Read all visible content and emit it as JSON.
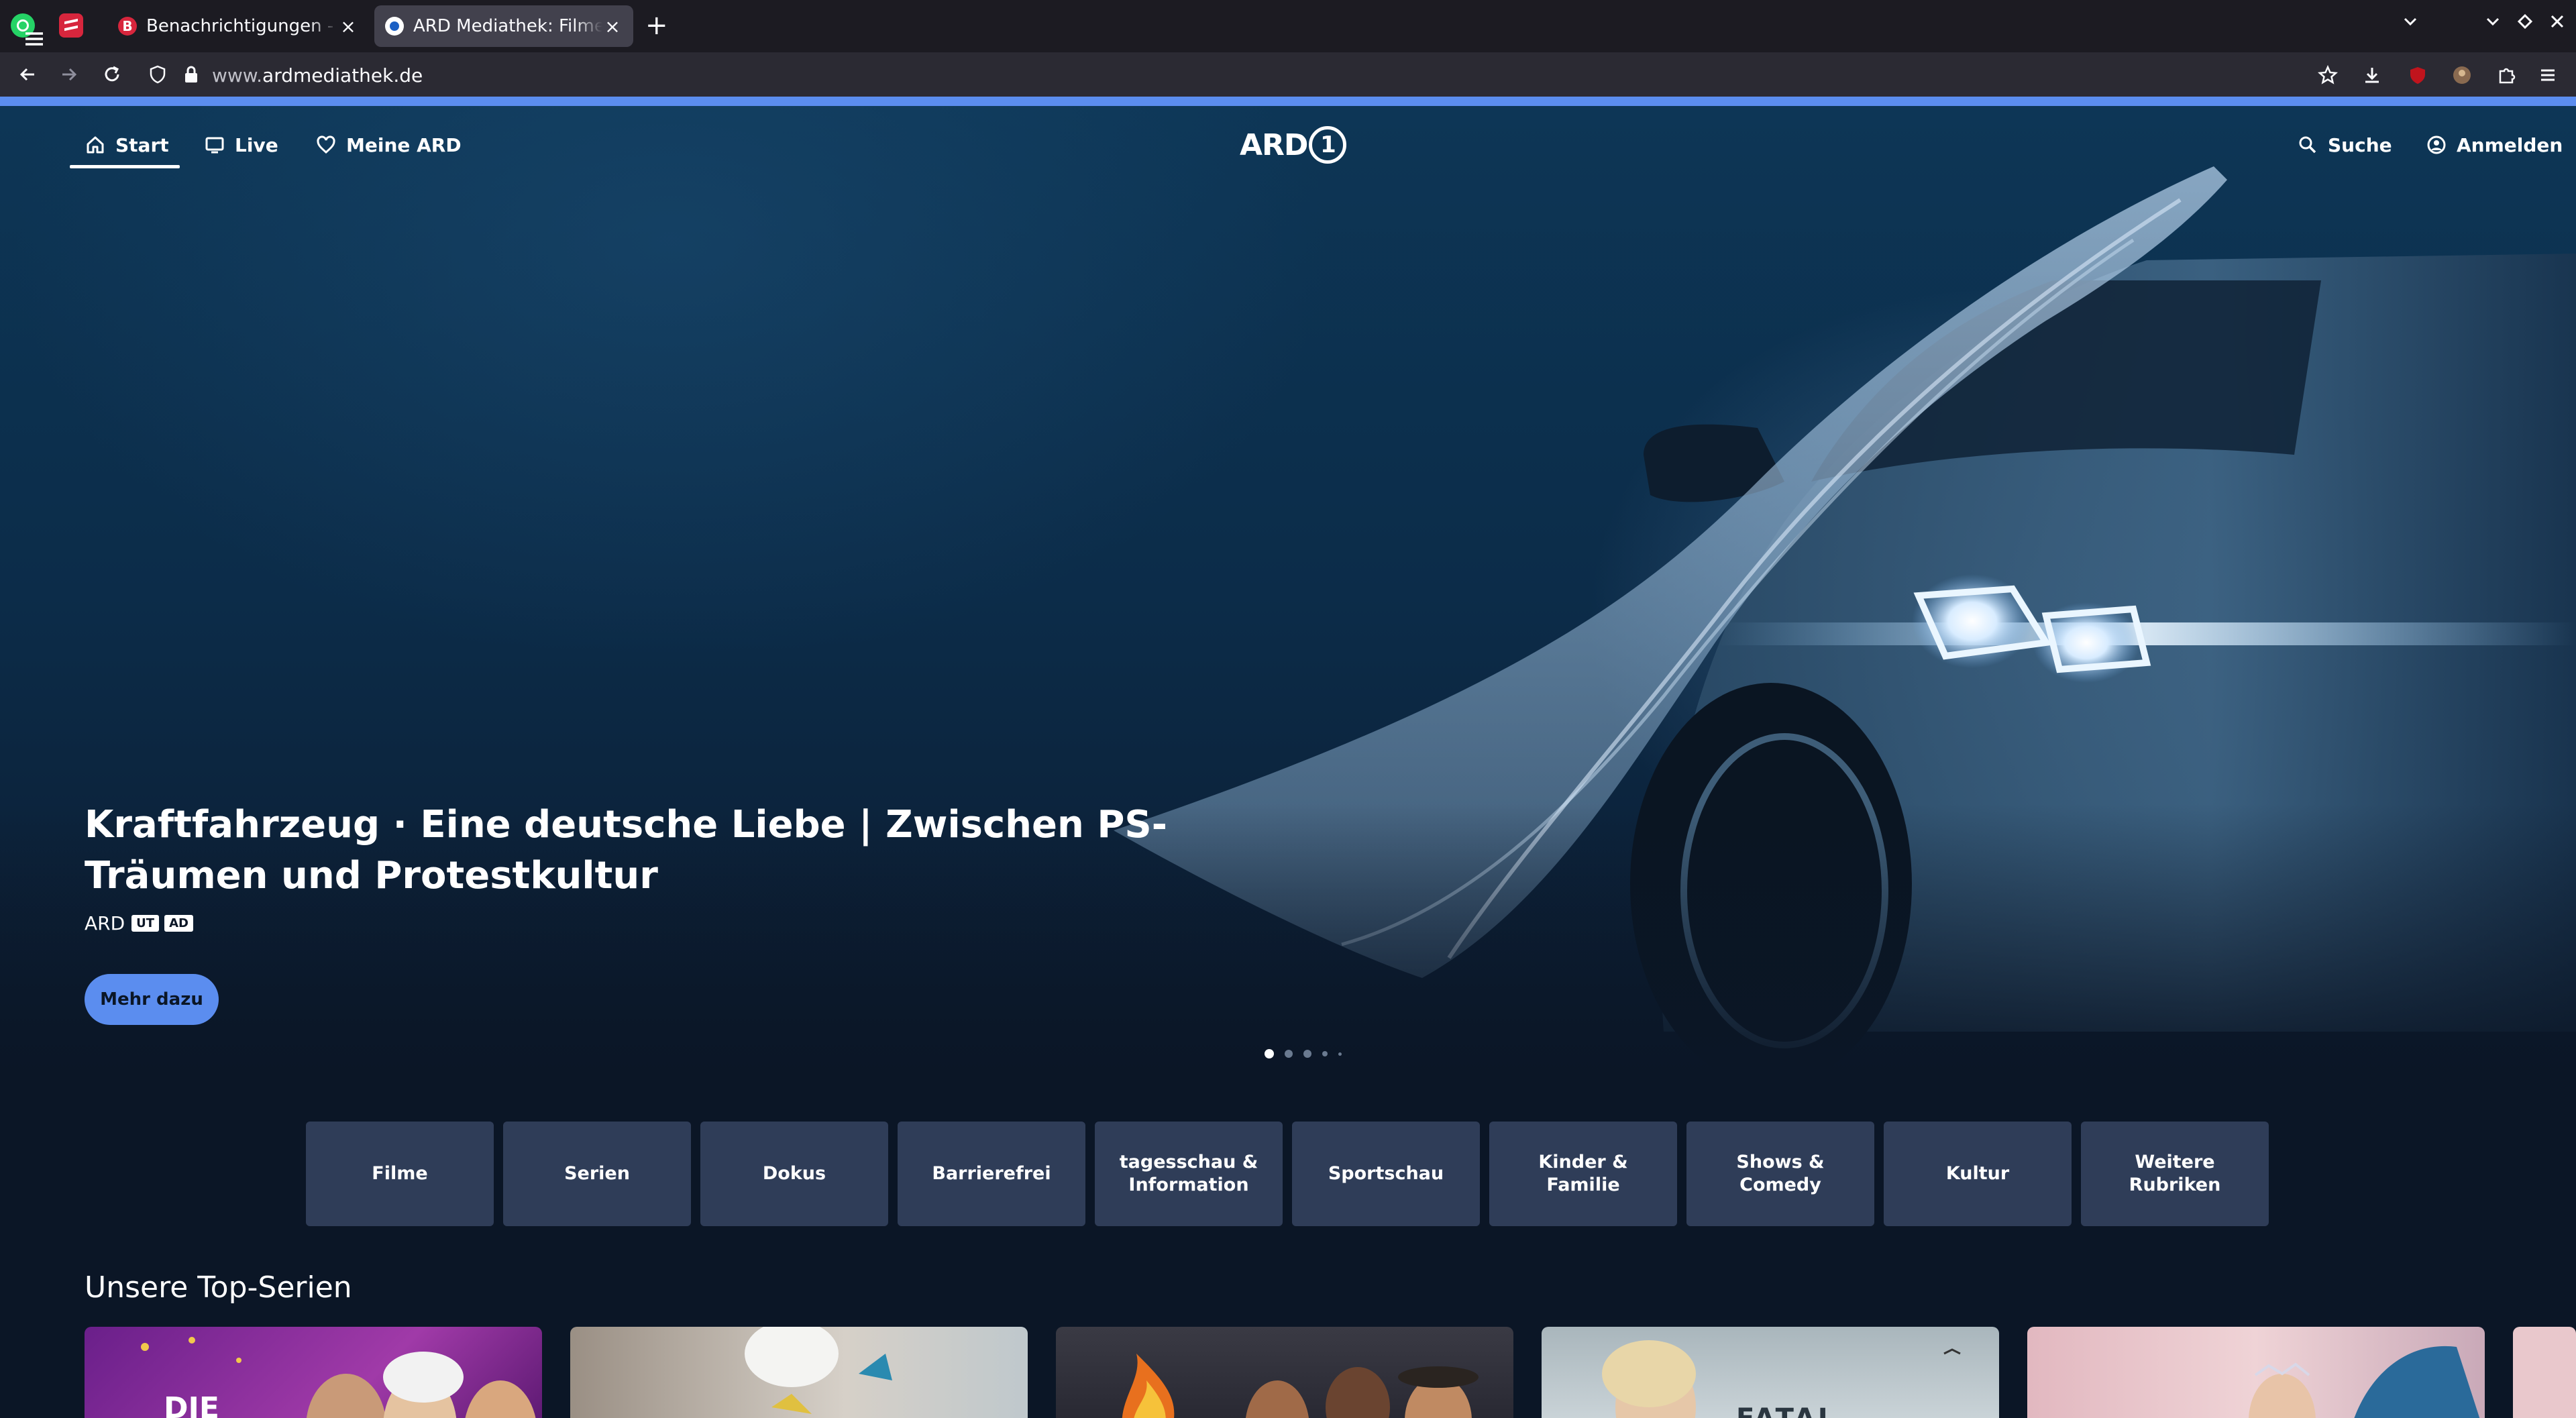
{
  "browser": {
    "tabs": [
      {
        "title": "Benachrichtigungen - Bonn",
        "close": "×"
      },
      {
        "title": "ARD Mediathek: Filme, Serien",
        "close": "×"
      }
    ],
    "new_tab": "+",
    "url_domain": "ardmediathek.de",
    "url_prefix": "www.",
    "accent": "#5b8def"
  },
  "site": {
    "logo_text": "ARD",
    "logo_number": "1",
    "nav": {
      "menu_icon": "hamburger-icon",
      "start": "Start",
      "live": "Live",
      "meine": "Meine ARD",
      "search": "Suche",
      "login": "Anmelden"
    }
  },
  "hero": {
    "title": "Kraftfahrzeug · Eine deutsche Liebe | Zwischen PS-Träumen und Protestkultur",
    "channel": "ARD",
    "badges": [
      "UT",
      "AD"
    ],
    "button": "Mehr dazu",
    "slides": 5,
    "active_slide": 1
  },
  "categories": [
    "Filme",
    "Serien",
    "Dokus",
    "Barrierefrei",
    "tagesschau &\nInformation",
    "Sportschau",
    "Kinder & Familie",
    "Shows &\nComedy",
    "Kultur",
    "Weitere\nRubriken"
  ],
  "top_series": {
    "heading": "Unsere Top-Serien",
    "cards": [
      {
        "visible_text": "DIE"
      },
      {
        "visible_text": ""
      },
      {
        "visible_text": ""
      },
      {
        "visible_text": "FATAL CROSSING"
      },
      {
        "visible_text": ""
      }
    ]
  }
}
